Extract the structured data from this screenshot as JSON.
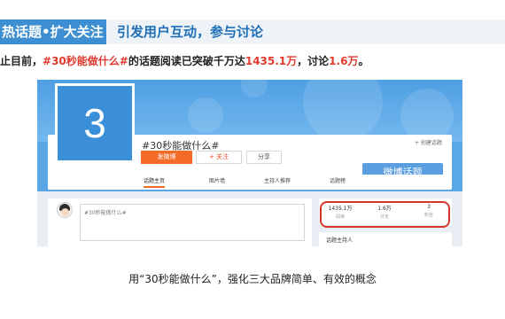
{
  "header": {
    "tag": "热话题•扩大关注",
    "title": "引发用户互动，参与讨论"
  },
  "stat_line": {
    "prefix": "止目前，",
    "topic": "#30秒能做什么#",
    "middle": "的话题阅读已突破千万达",
    "reads": "1435.1万",
    "sep": "，讨论",
    "discussions": "1.6万",
    "end": "。"
  },
  "page": {
    "avatar_text": "3",
    "topic_name": "#30秒能做什么#",
    "buttons": {
      "post": "发微博",
      "follow": "+ 关注",
      "share": "分享",
      "create_topic": "+ 创建话题",
      "weibo_topic": "微博话题"
    },
    "tabs": [
      "话题主页",
      "图片墙",
      "主持人推荐",
      "话题榜"
    ],
    "post_placeholder": "#30秒能做什么#",
    "stats": [
      {
        "value": "1435.1万",
        "label": "阅读"
      },
      {
        "value": "1.6万",
        "label": "讨论"
      },
      {
        "value": "3",
        "label": "粉丝"
      }
    ],
    "host_title": "话题主持人"
  },
  "caption": "用“30秒能做什么”，强化三大品牌简单、有效的概念",
  "colors": {
    "accent_blue": "#3d8fd1",
    "highlight_red": "#e23a2e",
    "button_orange": "#f46b28"
  }
}
